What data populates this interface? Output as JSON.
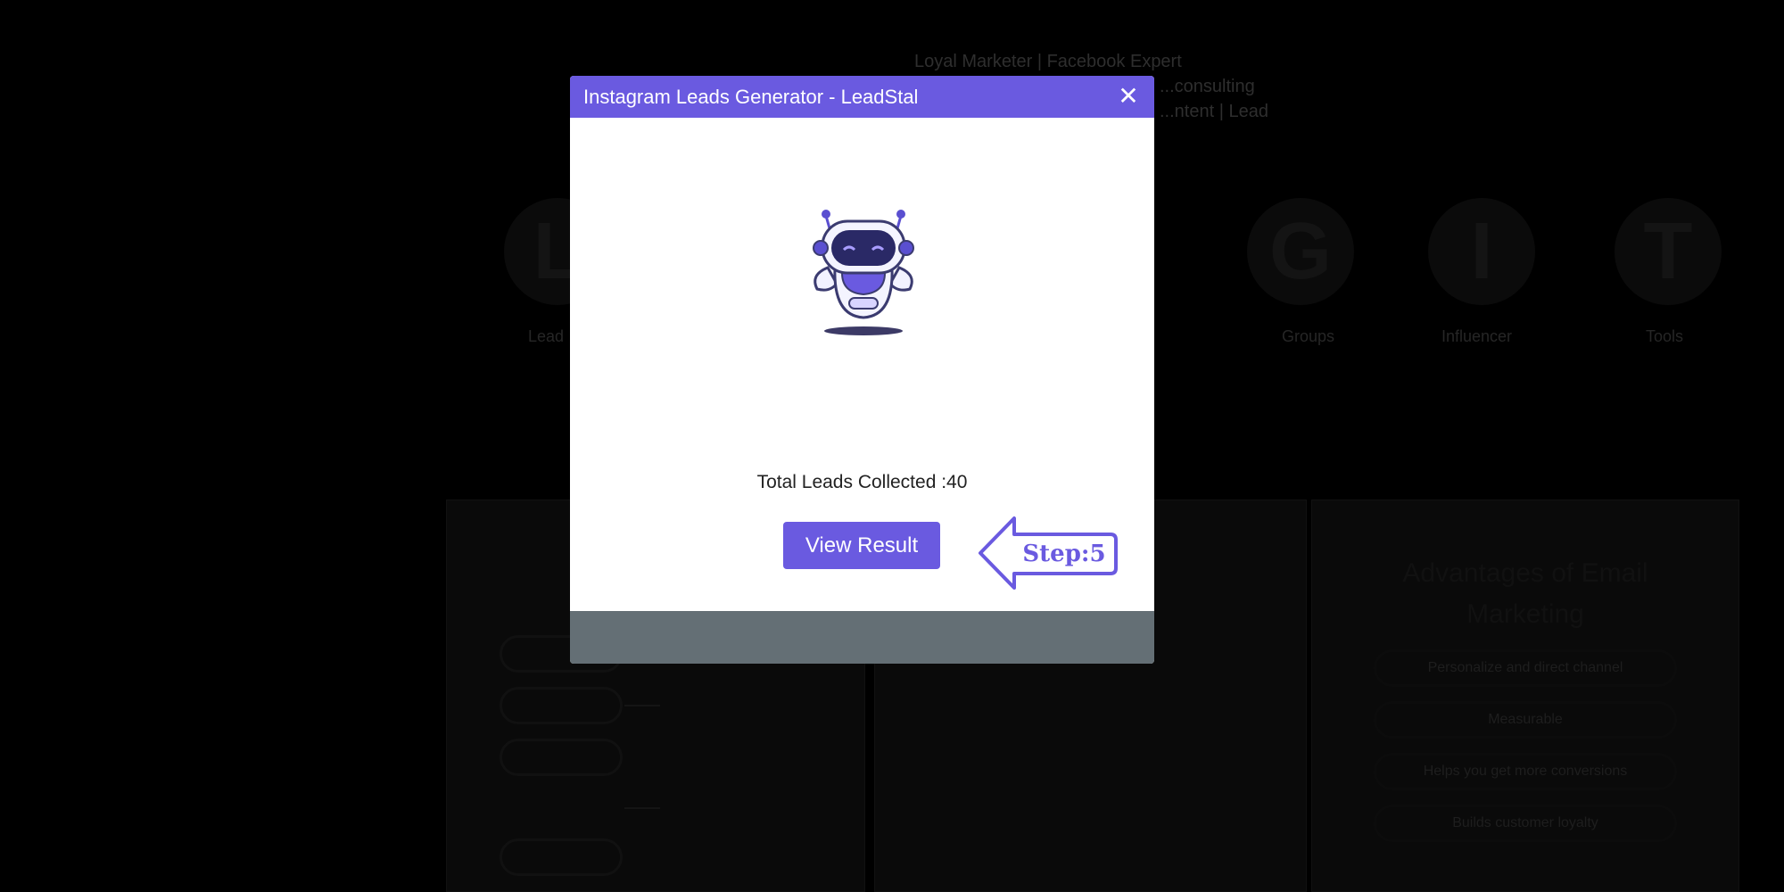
{
  "background": {
    "top_lines": [
      "Loyal Marketer | Facebook Expert",
      "...consulting",
      "...ntent | Lead"
    ],
    "categories": [
      {
        "letter": "L",
        "label": "Lead"
      },
      {
        "letter": "G",
        "label": "Groups"
      },
      {
        "letter": "I",
        "label": "Influencer"
      },
      {
        "letter": "T",
        "label": "Tools"
      }
    ],
    "card_heading": "Advantages of Email Marketing",
    "card_items": [
      "Personalize and direct channel",
      "Measurable",
      "Helps you get more conversions",
      "Builds customer loyalty"
    ]
  },
  "modal": {
    "title": "Instagram Leads Generator - LeadStal",
    "close_symbol": "✕",
    "leads_label": "Total Leads Collected : ",
    "leads_count": "40",
    "view_button": "View Result",
    "step_label": "Step:5"
  },
  "colors": {
    "accent": "#6A5AE0",
    "footer": "#646F75",
    "overlay": "#000000"
  },
  "icons": {
    "robot": "robot-mascot-icon",
    "close": "close-icon",
    "step": "left-arrow-icon"
  }
}
